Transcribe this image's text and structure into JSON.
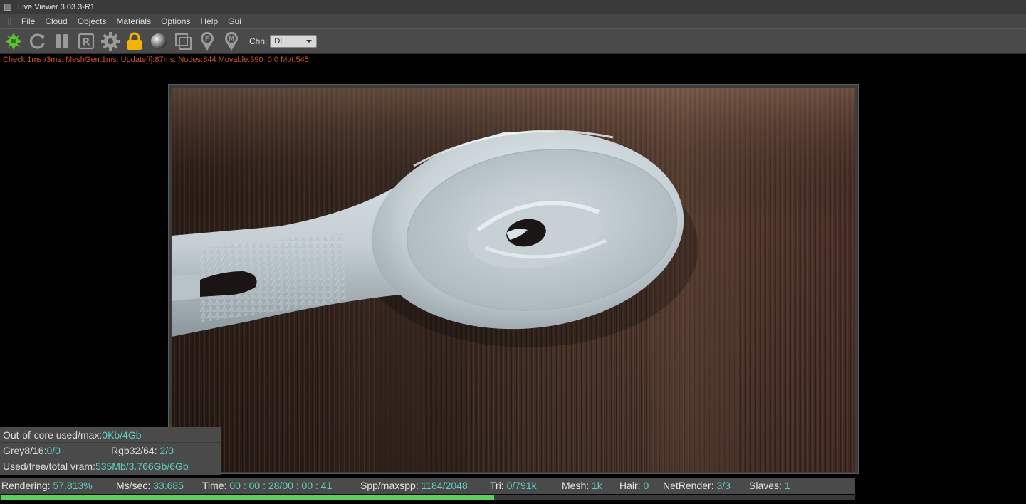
{
  "window": {
    "title": "Live Viewer 3.03.3-R1"
  },
  "menu": [
    "File",
    "Cloud",
    "Objects",
    "Materials",
    "Options",
    "Help",
    "Gui"
  ],
  "toolbar": {
    "icons": [
      "octane-logo-icon",
      "refresh-icon",
      "pause-icon",
      "restart-r-icon",
      "settings-gear-icon",
      "lock-icon",
      "material-sphere-icon",
      "region-icon",
      "focus-picker-icon",
      "material-picker-icon"
    ],
    "focus_pin_letter": "F",
    "material_pin_letter": "M",
    "restart_letter": "R",
    "channel_label": "Chn:",
    "channel_value": "DL"
  },
  "status_line": "Check:1ms./3ms. MeshGen:1ms. Update[I]:87ms. Nodes:844 Movable:390  0 0 Mot:545",
  "info_panel": {
    "out_of_core_label": "Out-of-core used/max:",
    "out_of_core_value": "0Kb/4Gb",
    "grey_label": "Grey8/16: ",
    "grey_value": "0/0",
    "rgb_label": "Rgb32/64: ",
    "rgb_value": "2/0",
    "vram_label": "Used/free/total vram: ",
    "vram_value": "535Mb/3.766Gb/6Gb"
  },
  "stats": {
    "rendering_label": "Rendering: ",
    "rendering_value": "57.813%",
    "mssec_label": "Ms/sec: ",
    "mssec_value": "33.685",
    "time_label": "Time: ",
    "time_value": "00 : 00 : 28/00 : 00 : 41",
    "spp_label": "Spp/maxspp: ",
    "spp_value": "1184/2048",
    "tri_label": "Tri: ",
    "tri_value": "0/791k",
    "mesh_label": "Mesh: ",
    "mesh_value": "1k",
    "hair_label": "Hair: ",
    "hair_value": "0",
    "netrender_label": "NetRender: ",
    "netrender_value": "3/3",
    "slaves_label": "Slaves: ",
    "slaves_value": "1"
  },
  "progress": {
    "fraction": 0.57813
  },
  "colors": {
    "status_text": "#d0502a",
    "value_text": "#5fd0c2",
    "progress": "#5ad25a",
    "logo_green": "#5cc332",
    "lock_yellow": "#f0b400",
    "hair_dark": "#3a2a22",
    "brush_body": "#c9d3d8"
  }
}
